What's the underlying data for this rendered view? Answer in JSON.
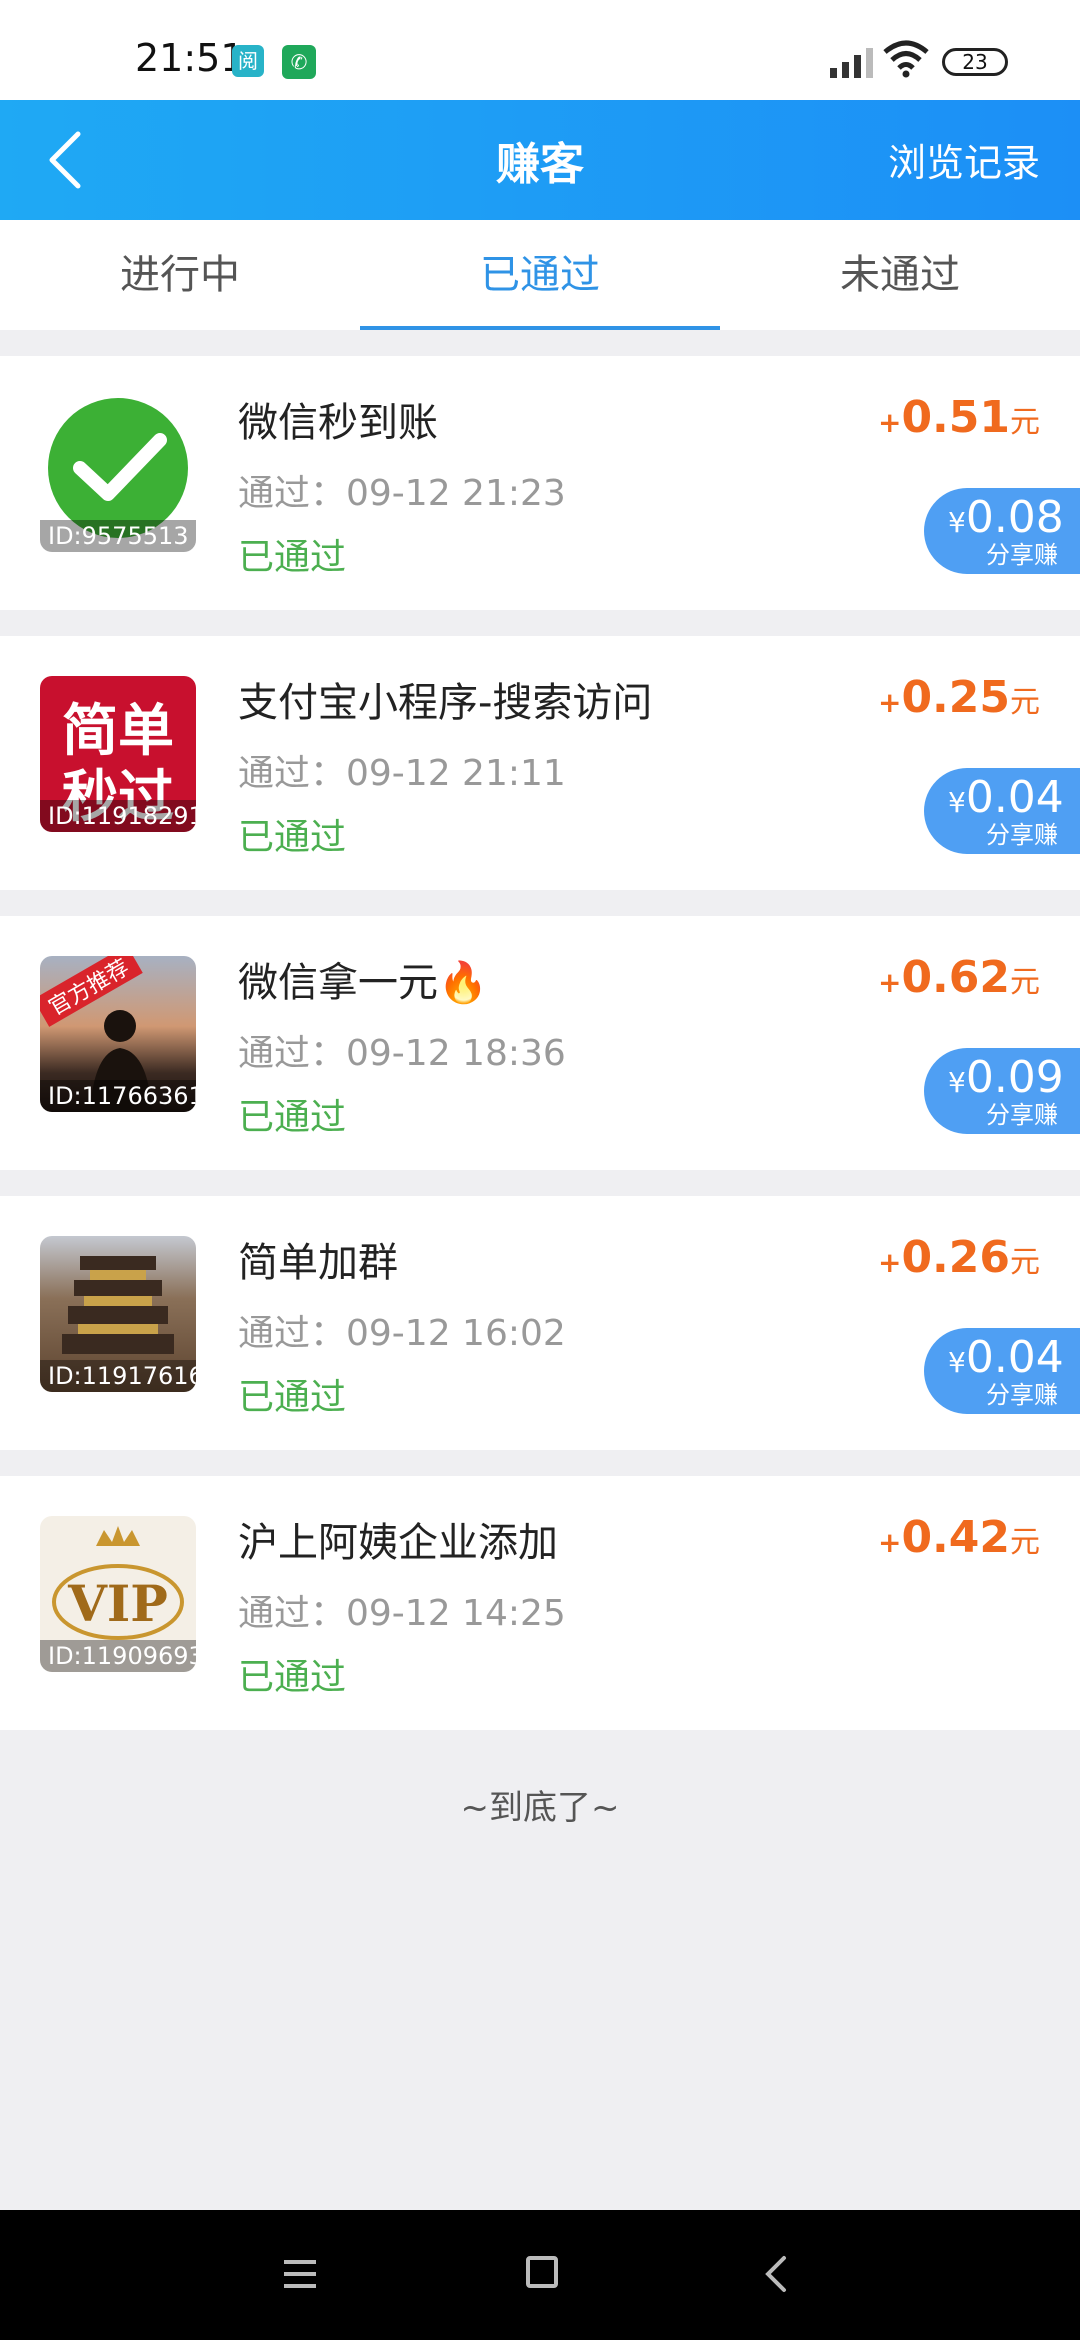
{
  "status_bar": {
    "time": "21:51",
    "app1_glyph": "阅",
    "app2_glyph": "✆",
    "battery": "23"
  },
  "header": {
    "title": "赚客",
    "history_label": "浏览记录"
  },
  "tabs": [
    {
      "label": "进行中",
      "active": false
    },
    {
      "label": "已通过",
      "active": true
    },
    {
      "label": "未通过",
      "active": false
    }
  ],
  "items": [
    {
      "title": "微信秒到账",
      "pass_time": "通过：09-12 21:23",
      "status": "已通过",
      "reward_sign": "+",
      "reward": "0.51",
      "reward_unit": "元",
      "share_amount": "0.08",
      "share_label": "分享赚",
      "thumb_id": "ID:9575513",
      "icon": "wechat-check-icon"
    },
    {
      "title": "支付宝小程序-搜索访问",
      "pass_time": "通过：09-12 21:11",
      "status": "已通过",
      "reward_sign": "+",
      "reward": "0.25",
      "reward_unit": "元",
      "share_amount": "0.04",
      "share_label": "分享赚",
      "thumb_id": "ID:11918291",
      "thumb_text_1": "简单",
      "thumb_text_2": "秒过",
      "icon": "simple-fast-badge-icon"
    },
    {
      "title": "微信拿一元🔥",
      "pass_time": "通过：09-12 18:36",
      "status": "已通过",
      "reward_sign": "+",
      "reward": "0.62",
      "reward_unit": "元",
      "share_amount": "0.09",
      "share_label": "分享赚",
      "thumb_id": "ID:11766361",
      "thumb_ribbon": "官方推荐",
      "icon": "photo-thumbnail-icon"
    },
    {
      "title": "简单加群",
      "pass_time": "通过：09-12 16:02",
      "status": "已通过",
      "reward_sign": "+",
      "reward": "0.26",
      "reward_unit": "元",
      "share_amount": "0.04",
      "share_label": "分享赚",
      "thumb_id": "ID:11917616",
      "icon": "tower-thumbnail-icon"
    },
    {
      "title": "沪上阿姨企业添加",
      "pass_time": "通过：09-12 14:25",
      "status": "已通过",
      "reward_sign": "+",
      "reward": "0.42",
      "reward_unit": "元",
      "thumb_id": "ID:11909693",
      "thumb_text": "VIP",
      "icon": "vip-crown-icon"
    }
  ],
  "footer_note": "~到底了~",
  "colors": {
    "header_start": "#1fa9f4",
    "header_end": "#1c8ff6",
    "reward": "#f06a1e",
    "status_green": "#4caf50",
    "share_pill": "#4f9ff3",
    "tab_active": "#2f93e6"
  }
}
